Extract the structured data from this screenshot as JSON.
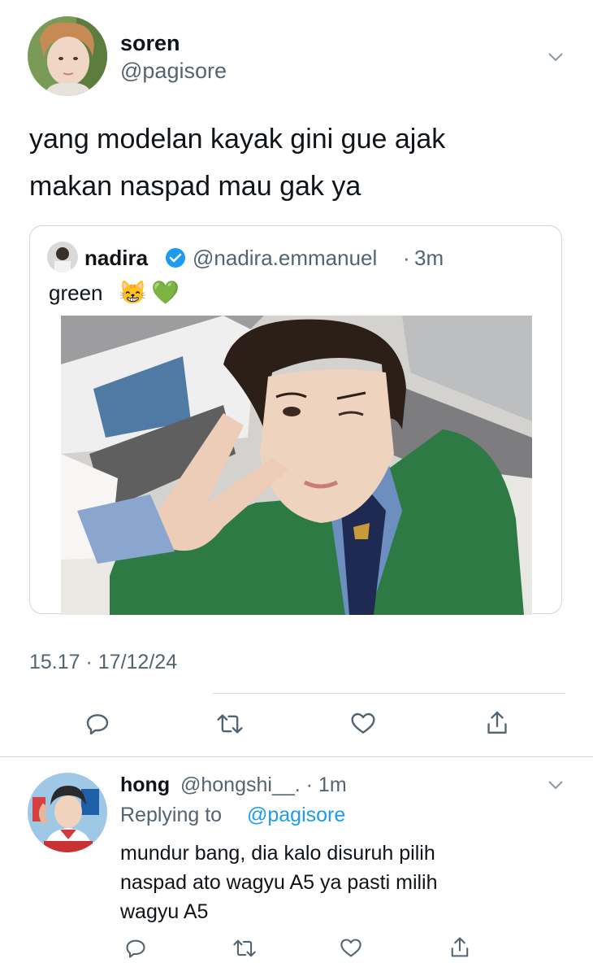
{
  "main_tweet": {
    "display_name": "soren",
    "handle": "@pagisore",
    "text_line1": "yang modelan kayak gini gue ajak",
    "text_line2": "makan naspad mau gak ya",
    "timestamp": "15.17 · 17/12/24"
  },
  "quoted_tweet": {
    "display_name": "nadira",
    "verified": true,
    "handle": "@nadira.emmanuel",
    "time_sep": "·",
    "time": "3m",
    "text": "green",
    "emojis": [
      "😸",
      "💚"
    ]
  },
  "reply": {
    "display_name": "hong",
    "handle_time": "@hongshi__. · 1m",
    "replying_prefix": "Replying to",
    "replying_to": "@pagisore",
    "text_line1": "mundur bang, dia kalo disuruh pilih",
    "text_line2": "naspad ato wagyu A5 ya pasti milih",
    "text_line3": "wagyu A5"
  },
  "colors": {
    "accent": "#1d9bf0",
    "muted": "#536471",
    "cardigan_green": "#2e7a45"
  }
}
